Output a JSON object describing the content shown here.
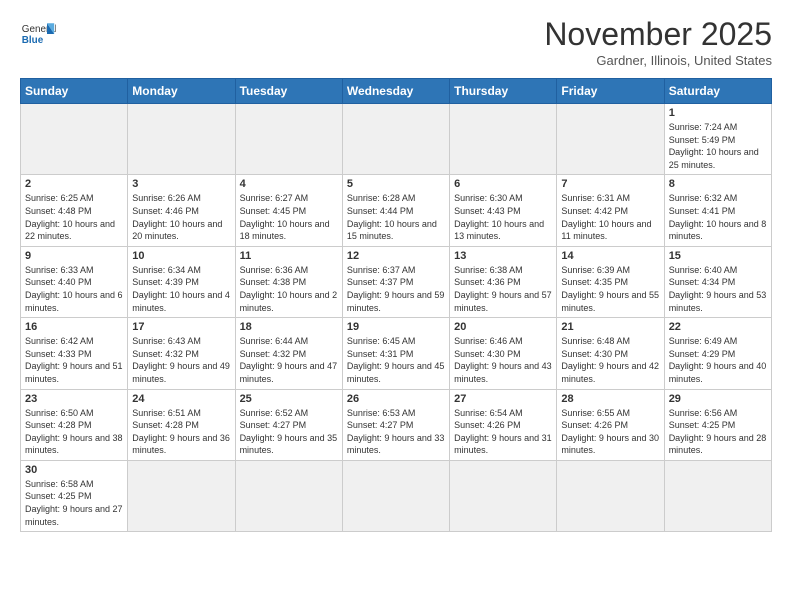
{
  "header": {
    "logo_general": "General",
    "logo_blue": "Blue",
    "month_title": "November 2025",
    "location": "Gardner, Illinois, United States"
  },
  "days_of_week": [
    "Sunday",
    "Monday",
    "Tuesday",
    "Wednesday",
    "Thursday",
    "Friday",
    "Saturday"
  ],
  "weeks": [
    [
      {
        "day": "",
        "info": ""
      },
      {
        "day": "",
        "info": ""
      },
      {
        "day": "",
        "info": ""
      },
      {
        "day": "",
        "info": ""
      },
      {
        "day": "",
        "info": ""
      },
      {
        "day": "",
        "info": ""
      },
      {
        "day": "1",
        "info": "Sunrise: 7:24 AM\nSunset: 5:49 PM\nDaylight: 10 hours and 25 minutes."
      }
    ],
    [
      {
        "day": "2",
        "info": "Sunrise: 6:25 AM\nSunset: 4:48 PM\nDaylight: 10 hours and 22 minutes."
      },
      {
        "day": "3",
        "info": "Sunrise: 6:26 AM\nSunset: 4:46 PM\nDaylight: 10 hours and 20 minutes."
      },
      {
        "day": "4",
        "info": "Sunrise: 6:27 AM\nSunset: 4:45 PM\nDaylight: 10 hours and 18 minutes."
      },
      {
        "day": "5",
        "info": "Sunrise: 6:28 AM\nSunset: 4:44 PM\nDaylight: 10 hours and 15 minutes."
      },
      {
        "day": "6",
        "info": "Sunrise: 6:30 AM\nSunset: 4:43 PM\nDaylight: 10 hours and 13 minutes."
      },
      {
        "day": "7",
        "info": "Sunrise: 6:31 AM\nSunset: 4:42 PM\nDaylight: 10 hours and 11 minutes."
      },
      {
        "day": "8",
        "info": "Sunrise: 6:32 AM\nSunset: 4:41 PM\nDaylight: 10 hours and 8 minutes."
      }
    ],
    [
      {
        "day": "9",
        "info": "Sunrise: 6:33 AM\nSunset: 4:40 PM\nDaylight: 10 hours and 6 minutes."
      },
      {
        "day": "10",
        "info": "Sunrise: 6:34 AM\nSunset: 4:39 PM\nDaylight: 10 hours and 4 minutes."
      },
      {
        "day": "11",
        "info": "Sunrise: 6:36 AM\nSunset: 4:38 PM\nDaylight: 10 hours and 2 minutes."
      },
      {
        "day": "12",
        "info": "Sunrise: 6:37 AM\nSunset: 4:37 PM\nDaylight: 9 hours and 59 minutes."
      },
      {
        "day": "13",
        "info": "Sunrise: 6:38 AM\nSunset: 4:36 PM\nDaylight: 9 hours and 57 minutes."
      },
      {
        "day": "14",
        "info": "Sunrise: 6:39 AM\nSunset: 4:35 PM\nDaylight: 9 hours and 55 minutes."
      },
      {
        "day": "15",
        "info": "Sunrise: 6:40 AM\nSunset: 4:34 PM\nDaylight: 9 hours and 53 minutes."
      }
    ],
    [
      {
        "day": "16",
        "info": "Sunrise: 6:42 AM\nSunset: 4:33 PM\nDaylight: 9 hours and 51 minutes."
      },
      {
        "day": "17",
        "info": "Sunrise: 6:43 AM\nSunset: 4:32 PM\nDaylight: 9 hours and 49 minutes."
      },
      {
        "day": "18",
        "info": "Sunrise: 6:44 AM\nSunset: 4:32 PM\nDaylight: 9 hours and 47 minutes."
      },
      {
        "day": "19",
        "info": "Sunrise: 6:45 AM\nSunset: 4:31 PM\nDaylight: 9 hours and 45 minutes."
      },
      {
        "day": "20",
        "info": "Sunrise: 6:46 AM\nSunset: 4:30 PM\nDaylight: 9 hours and 43 minutes."
      },
      {
        "day": "21",
        "info": "Sunrise: 6:48 AM\nSunset: 4:30 PM\nDaylight: 9 hours and 42 minutes."
      },
      {
        "day": "22",
        "info": "Sunrise: 6:49 AM\nSunset: 4:29 PM\nDaylight: 9 hours and 40 minutes."
      }
    ],
    [
      {
        "day": "23",
        "info": "Sunrise: 6:50 AM\nSunset: 4:28 PM\nDaylight: 9 hours and 38 minutes."
      },
      {
        "day": "24",
        "info": "Sunrise: 6:51 AM\nSunset: 4:28 PM\nDaylight: 9 hours and 36 minutes."
      },
      {
        "day": "25",
        "info": "Sunrise: 6:52 AM\nSunset: 4:27 PM\nDaylight: 9 hours and 35 minutes."
      },
      {
        "day": "26",
        "info": "Sunrise: 6:53 AM\nSunset: 4:27 PM\nDaylight: 9 hours and 33 minutes."
      },
      {
        "day": "27",
        "info": "Sunrise: 6:54 AM\nSunset: 4:26 PM\nDaylight: 9 hours and 31 minutes."
      },
      {
        "day": "28",
        "info": "Sunrise: 6:55 AM\nSunset: 4:26 PM\nDaylight: 9 hours and 30 minutes."
      },
      {
        "day": "29",
        "info": "Sunrise: 6:56 AM\nSunset: 4:25 PM\nDaylight: 9 hours and 28 minutes."
      }
    ],
    [
      {
        "day": "30",
        "info": "Sunrise: 6:58 AM\nSunset: 4:25 PM\nDaylight: 9 hours and 27 minutes."
      },
      {
        "day": "",
        "info": ""
      },
      {
        "day": "",
        "info": ""
      },
      {
        "day": "",
        "info": ""
      },
      {
        "day": "",
        "info": ""
      },
      {
        "day": "",
        "info": ""
      },
      {
        "day": "",
        "info": ""
      }
    ]
  ]
}
